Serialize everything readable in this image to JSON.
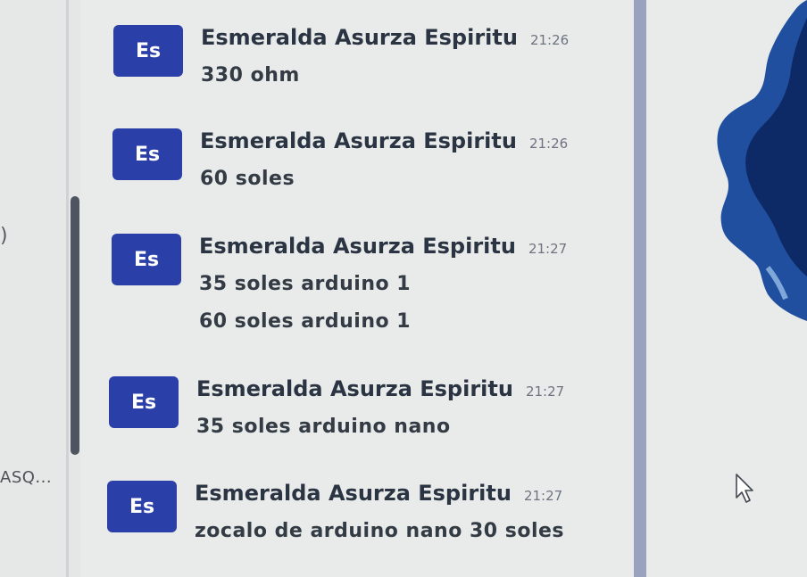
{
  "left_panel": {
    "truncated_label": "ASQ...",
    "glyph": ")"
  },
  "messages": [
    {
      "avatar": "Es",
      "sender": "Esmeralda Asurza Espiritu",
      "time": "21:26",
      "lines": [
        "330 ohm"
      ]
    },
    {
      "avatar": "Es",
      "sender": "Esmeralda Asurza Espiritu",
      "time": "21:26",
      "lines": [
        "60 soles"
      ]
    },
    {
      "avatar": "Es",
      "sender": "Esmeralda Asurza Espiritu",
      "time": "21:27",
      "lines": [
        "35 soles arduino 1",
        "60 soles arduino 1"
      ]
    },
    {
      "avatar": "Es",
      "sender": "Esmeralda Asurza Espiritu",
      "time": "21:27",
      "lines": [
        "35 soles arduino nano"
      ]
    },
    {
      "avatar": "Es",
      "sender": "Esmeralda Asurza Espiritu",
      "time": "21:27",
      "lines": [
        "zocalo de arduino nano 30 soles"
      ]
    }
  ],
  "colors": {
    "avatar_bg": "#2b3fa8",
    "sender_text": "#2a3442",
    "scrollbar": "#4f5560",
    "divider": "#9aa3bd"
  },
  "icons": {
    "cursor": "mouse-pointer-icon"
  }
}
